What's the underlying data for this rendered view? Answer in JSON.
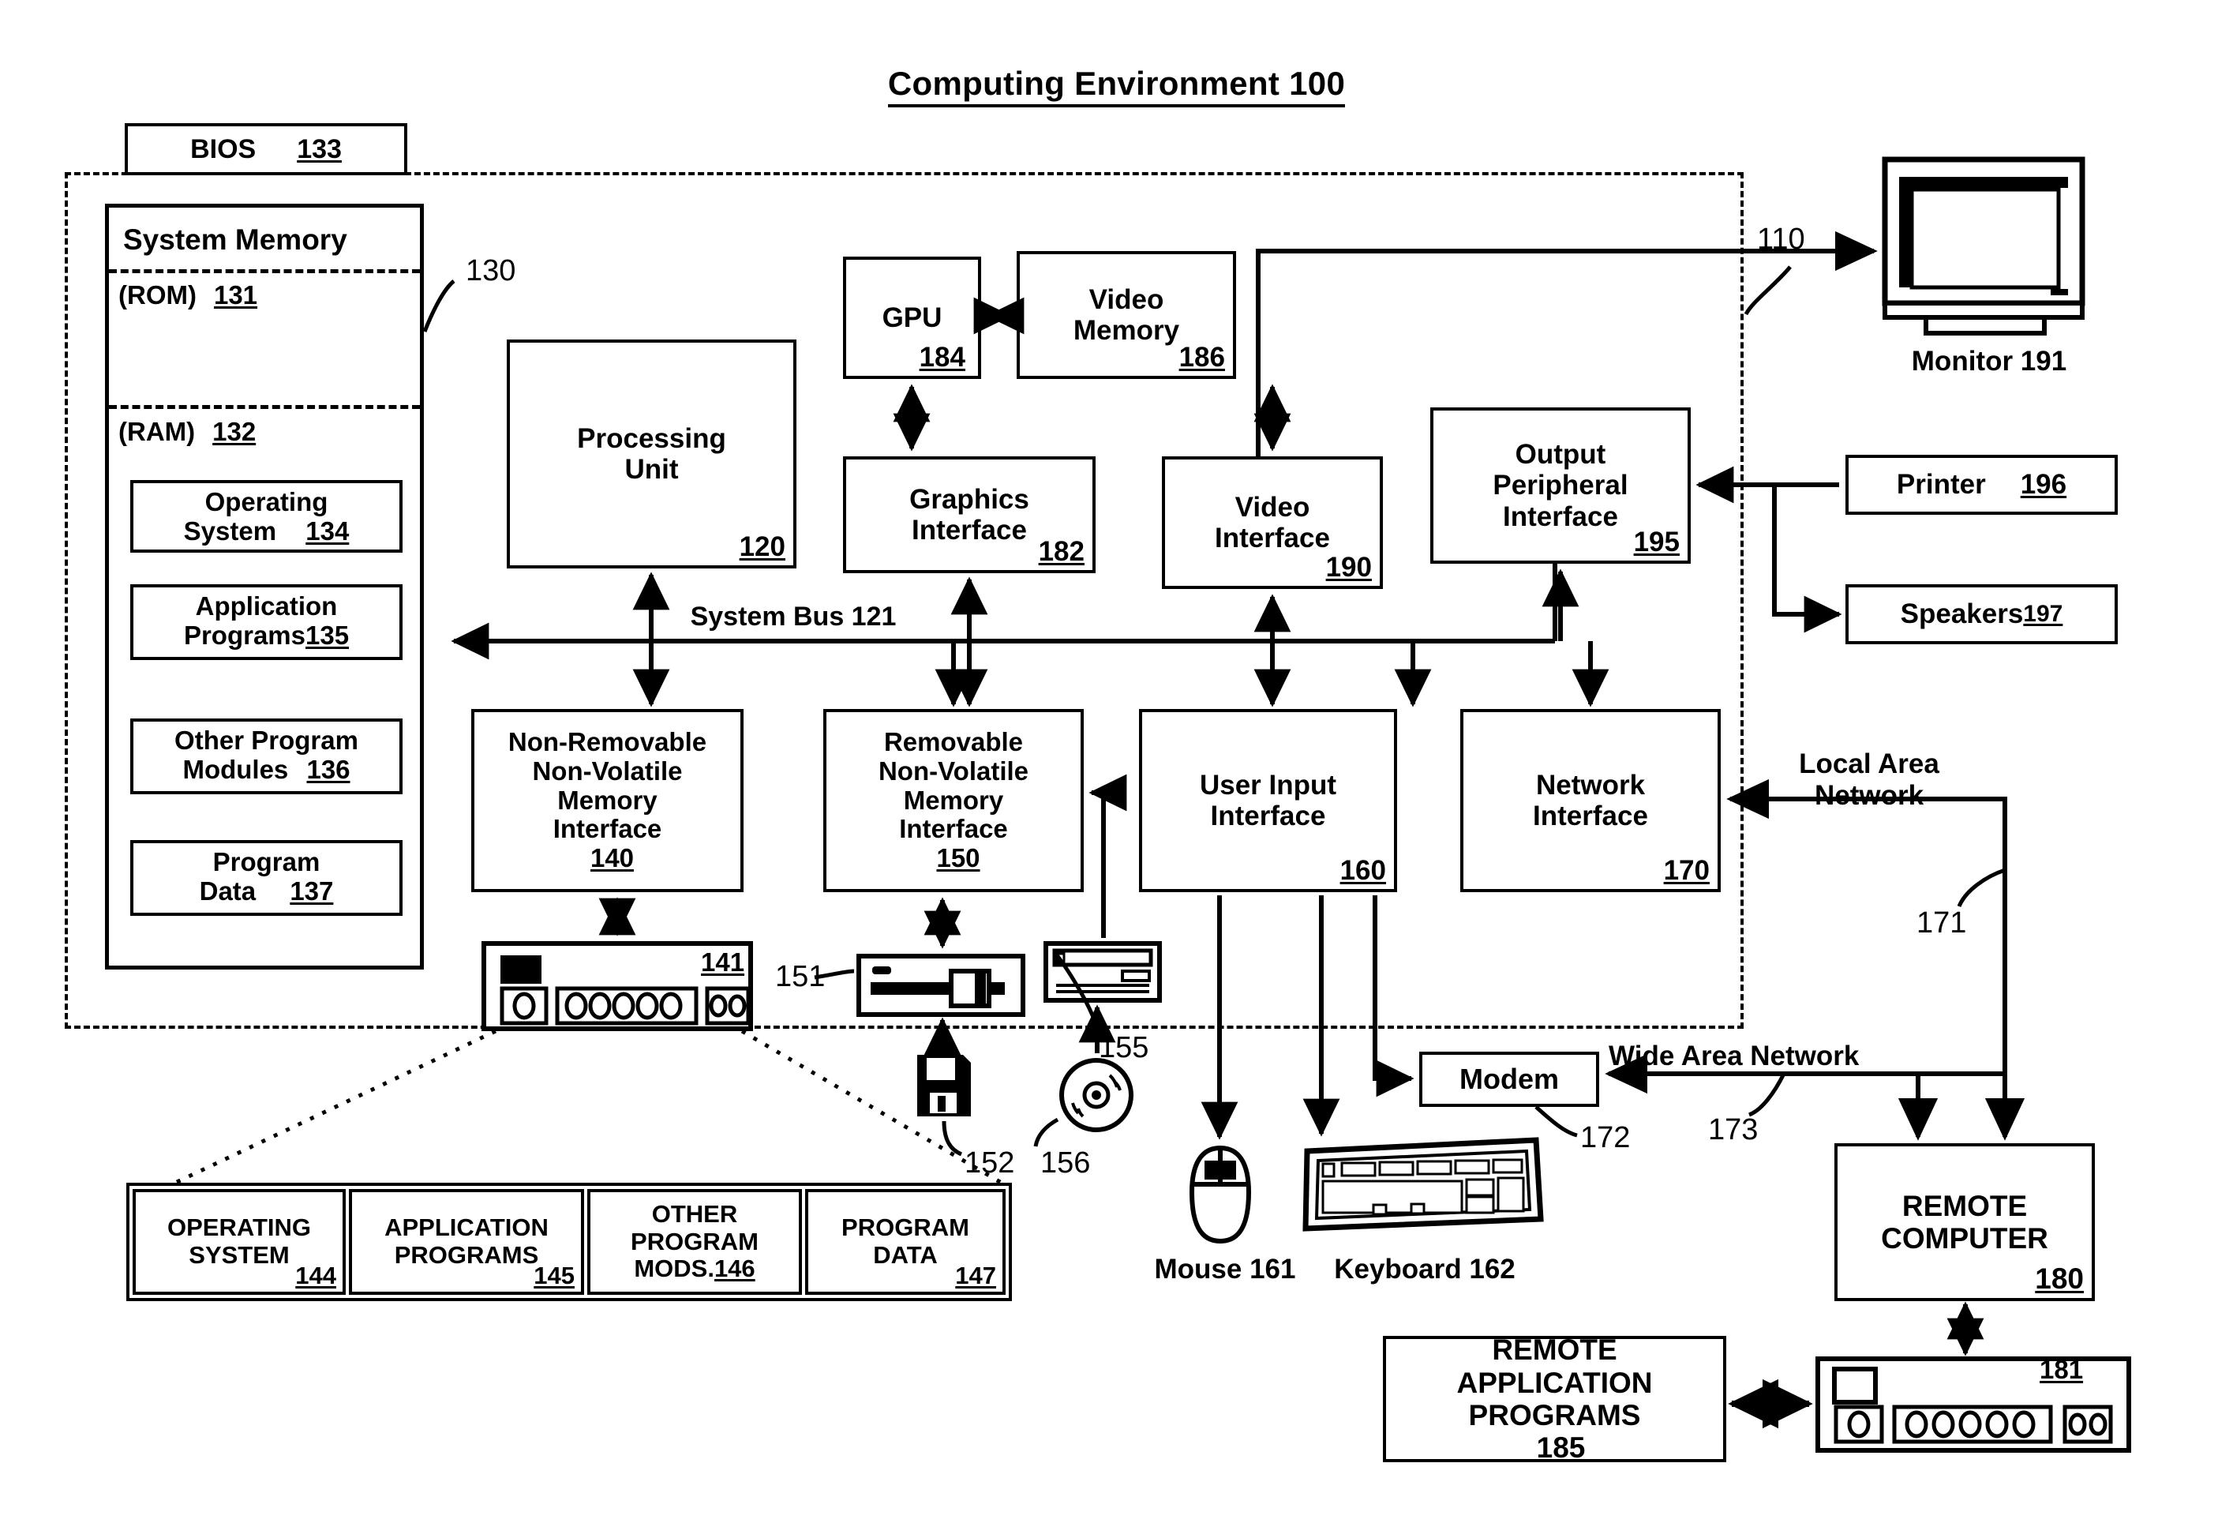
{
  "figure": {
    "title": "Computing Environment 100",
    "region_callout": "110",
    "system_bus": "System Bus 121"
  },
  "system_memory": {
    "title": "System Memory",
    "callout": "130",
    "rom_label": "(ROM)",
    "rom_num": "131",
    "ram_label": "(RAM)",
    "ram_num": "132",
    "items": [
      {
        "label": "BIOS",
        "num": "133"
      },
      {
        "label_line1": "Operating",
        "label_line2": "System",
        "num": "134"
      },
      {
        "label_line1": "Application",
        "label_line2": "Programs",
        "num": "135"
      },
      {
        "label_line1": "Other Program",
        "label_line2": "Modules",
        "num": "136"
      },
      {
        "label_line1": "Program",
        "label_line2": "Data",
        "num": "137"
      }
    ]
  },
  "blocks": {
    "processing_unit": {
      "line1": "Processing",
      "line2": "Unit",
      "num": "120"
    },
    "gpu": {
      "line1": "GPU",
      "num": "184"
    },
    "video_memory": {
      "line1": "Video",
      "line2": "Memory",
      "num": "186"
    },
    "graphics_interface": {
      "line1": "Graphics",
      "line2": "Interface",
      "num": "182"
    },
    "video_interface": {
      "line1": "Video",
      "line2": "Interface",
      "num": "190"
    },
    "output_peripheral_interface": {
      "line1": "Output",
      "line2": "Peripheral",
      "line3": "Interface",
      "num": "195"
    },
    "nonremovable_interface": {
      "line1": "Non-Removable",
      "line2": "Non-Volatile",
      "line3": "Memory",
      "line4": "Interface",
      "num": "140"
    },
    "removable_interface": {
      "line1": "Removable",
      "line2": "Non-Volatile",
      "line3": "Memory",
      "line4": "Interface",
      "num": "150"
    },
    "user_input_interface": {
      "line1": "User Input",
      "line2": "Interface",
      "num": "160"
    },
    "network_interface": {
      "line1": "Network",
      "line2": "Interface",
      "num": "170"
    },
    "modem": {
      "label": "Modem",
      "num": "172"
    },
    "remote_computer": {
      "line1": "REMOTE",
      "line2": "COMPUTER",
      "num": "180"
    },
    "remote_app_programs": {
      "line1": "REMOTE",
      "line2": "APPLICATION",
      "line3": "PROGRAMS",
      "num": "185"
    },
    "printer": {
      "label": "Printer",
      "num": "196"
    },
    "speakers": {
      "label": "Speakers",
      "num": "197"
    }
  },
  "peripherals": {
    "monitor": {
      "label": "Monitor 191"
    },
    "mouse": {
      "line1": "Mouse",
      "line2": "161"
    },
    "keyboard": {
      "label": "Keyboard 162"
    },
    "hard_drive_num": "141",
    "floppy_drive_num": "151",
    "floppy_disk_num": "152",
    "optical_drive_num": "155",
    "optical_disc_num": "156",
    "remote_drive_num": "181"
  },
  "networks": {
    "lan_line1": "Local Area",
    "lan_line2": "Network",
    "lan_num": "171",
    "wan": "Wide Area Network",
    "wan_num": "173"
  },
  "storage_table": {
    "columns": [
      {
        "line1": "OPERATING",
        "line2": "SYSTEM",
        "num": "144"
      },
      {
        "line1": "APPLICATION",
        "line2": "PROGRAMS",
        "num": "145"
      },
      {
        "line1": "OTHER",
        "line2": "PROGRAM",
        "line3": "MODS.",
        "num": "146"
      },
      {
        "line1": "PROGRAM",
        "line2": "DATA",
        "num": "147"
      }
    ]
  },
  "colors": {
    "ink": "#000000",
    "paper": "#ffffff"
  }
}
